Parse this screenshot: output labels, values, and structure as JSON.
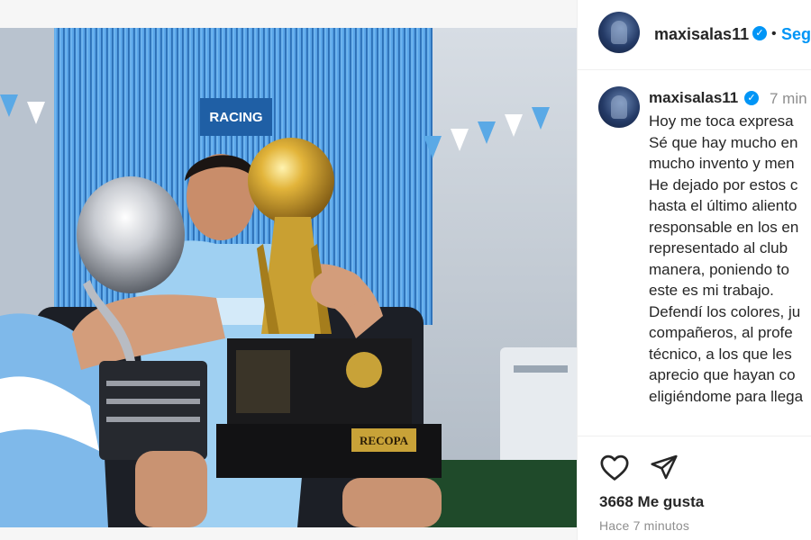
{
  "post": {
    "username": "maxisalas11",
    "follow_label": "Seg",
    "verified_mark": "✓",
    "caption": {
      "time": "7 min",
      "lines": [
        "Hoy me toca expresa",
        "Sé que hay mucho en",
        "mucho invento y men",
        "He dejado por estos c",
        "hasta el último aliento",
        "responsable en los en",
        "representado al club",
        "manera, poniendo to",
        "este es mi trabajo.",
        "Defendí los colores, ju",
        "compañeros, al profe",
        "técnico, a los que les",
        "aprecio que hayan co",
        "eligiéndome para llega"
      ]
    },
    "likes": "3668 Me gusta",
    "timestamp": "Hace 7 minutos"
  },
  "photo": {
    "banner_text": "RACING",
    "trophy_plaque": "RECOPA"
  },
  "icons": {
    "like": "heart-icon",
    "share": "paper-plane-icon",
    "verified": "verified-badge-icon"
  },
  "colors": {
    "accent": "#0095f6",
    "text": "#262626",
    "muted": "#8e8e8e",
    "border": "#efefef"
  }
}
